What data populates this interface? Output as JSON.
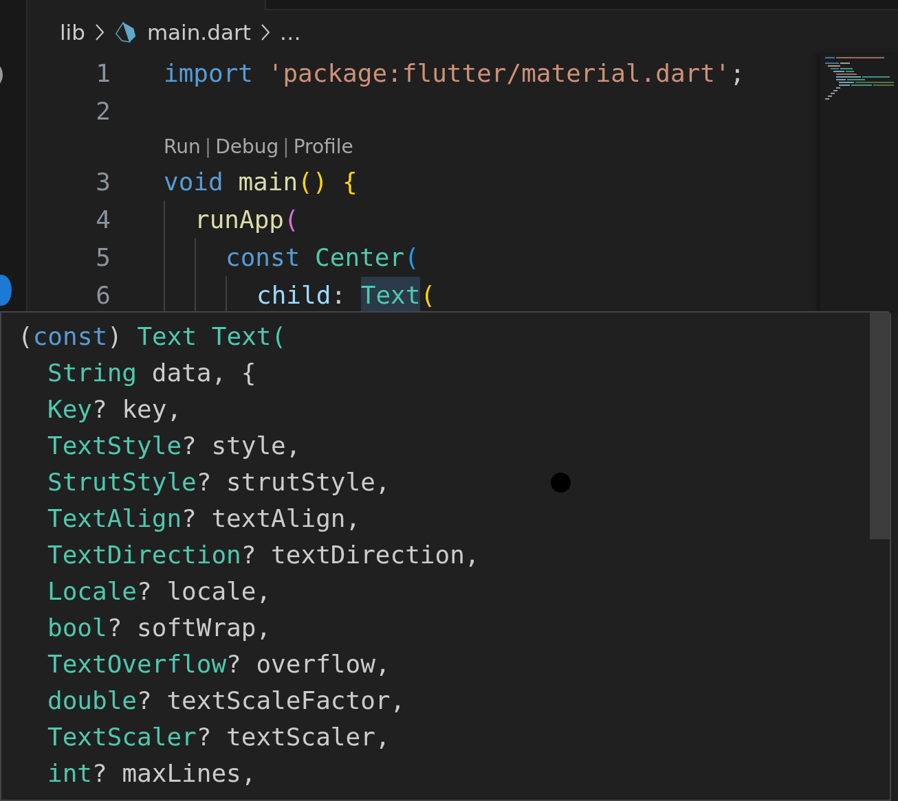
{
  "breadcrumb": {
    "segments": [
      {
        "text": "lib",
        "kind": "folder"
      },
      {
        "text": "main.dart",
        "kind": "dart-file"
      }
    ],
    "ellipsis": "…"
  },
  "code_lines": [
    {
      "kind": "line",
      "number": "1",
      "tokens": [
        {
          "text": "import",
          "kind": "keyword"
        },
        {
          "text": " 'package:flutter/material.dart'",
          "kind": "string"
        },
        {
          "text": ";",
          "kind": "plain"
        }
      ]
    },
    {
      "kind": "line",
      "number": "2"
    },
    {
      "kind": "codelens",
      "items": [
        {
          "text": "Run",
          "kind": "link"
        },
        {
          "text": "|",
          "kind": "separator"
        },
        {
          "text": "Debug",
          "kind": "link"
        },
        {
          "text": "|",
          "kind": "separator"
        },
        {
          "text": "Profile",
          "kind": "link"
        }
      ]
    },
    {
      "kind": "line",
      "number": "3",
      "tokens": [
        {
          "text": "void",
          "kind": "keyword"
        },
        {
          "text": " main",
          "kind": "function"
        },
        {
          "text": "()",
          "kind": "bracket1"
        },
        {
          "text": " {",
          "kind": "bracket1"
        }
      ],
      "children": [
        {
          "kind": "line",
          "number": "4",
          "tokens": [
            {
              "text": "runApp",
              "kind": "function"
            },
            {
              "text": "(",
              "kind": "bracket2"
            }
          ],
          "children": [
            {
              "kind": "line",
              "number": "5",
              "tokens": [
                {
                  "text": "const",
                  "kind": "keyword"
                },
                {
                  "text": " Center",
                  "kind": "type"
                },
                {
                  "text": "(",
                  "kind": "bracket3"
                }
              ],
              "children": [
                {
                  "kind": "line",
                  "number": "6",
                  "tokens": [
                    {
                      "text": "child",
                      "kind": "param"
                    },
                    {
                      "text": ": ",
                      "kind": "plain"
                    },
                    {
                      "text": "Text",
                      "kind": "type",
                      "highlighted": true
                    },
                    {
                      "text": "(",
                      "kind": "bracket1"
                    }
                  ]
                }
              ]
            }
          ]
        }
      ]
    }
  ],
  "hover": {
    "signature": {
      "tokens": [
        {
          "text": "(",
          "kind": "plain"
        },
        {
          "text": "const",
          "kind": "keyword"
        },
        {
          "text": ") ",
          "kind": "plain"
        },
        {
          "text": "Text",
          "kind": "type"
        },
        {
          "text": " Text(",
          "kind": "type"
        }
      ],
      "children": [
        {
          "tokens": [
            {
              "text": "String",
              "kind": "type"
            },
            {
              "text": " data, {",
              "kind": "plain"
            }
          ]
        },
        {
          "tokens": [
            {
              "text": "Key",
              "kind": "type"
            },
            {
              "text": "? key,",
              "kind": "plain"
            }
          ]
        },
        {
          "tokens": [
            {
              "text": "TextStyle",
              "kind": "type"
            },
            {
              "text": "? style,",
              "kind": "plain"
            }
          ]
        },
        {
          "tokens": [
            {
              "text": "StrutStyle",
              "kind": "type"
            },
            {
              "text": "? strutStyle,",
              "kind": "plain"
            }
          ]
        },
        {
          "tokens": [
            {
              "text": "TextAlign",
              "kind": "type"
            },
            {
              "text": "? textAlign,",
              "kind": "plain"
            }
          ]
        },
        {
          "tokens": [
            {
              "text": "TextDirection",
              "kind": "type"
            },
            {
              "text": "? textDirection,",
              "kind": "plain"
            }
          ]
        },
        {
          "tokens": [
            {
              "text": "Locale",
              "kind": "type"
            },
            {
              "text": "? locale,",
              "kind": "plain"
            }
          ]
        },
        {
          "tokens": [
            {
              "text": "bool",
              "kind": "type"
            },
            {
              "text": "? softWrap,",
              "kind": "plain"
            }
          ]
        },
        {
          "tokens": [
            {
              "text": "TextOverflow",
              "kind": "type"
            },
            {
              "text": "? overflow,",
              "kind": "plain"
            }
          ]
        },
        {
          "tokens": [
            {
              "text": "double",
              "kind": "type"
            },
            {
              "text": "? textScaleFactor,",
              "kind": "plain"
            }
          ]
        },
        {
          "tokens": [
            {
              "text": "TextScaler",
              "kind": "type"
            },
            {
              "text": "? textScaler,",
              "kind": "plain"
            }
          ]
        },
        {
          "tokens": [
            {
              "text": "int",
              "kind": "type"
            },
            {
              "text": "? maxLines,",
              "kind": "plain"
            }
          ]
        }
      ]
    }
  }
}
